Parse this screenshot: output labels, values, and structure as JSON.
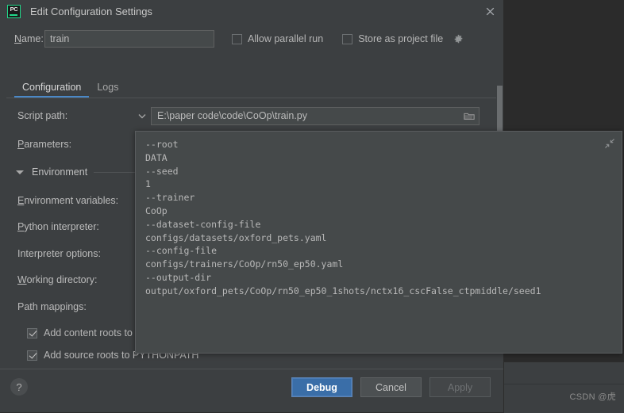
{
  "window": {
    "title": "Edit Configuration Settings",
    "app_icon": "pycharm-icon",
    "app_icon_text": "PC",
    "close_icon": "close-icon"
  },
  "name_row": {
    "label": "Name:",
    "label_mnemonic": "N",
    "value": "train",
    "checkboxes": [
      {
        "label": "Allow parallel run",
        "checked": false,
        "mnemonic": "u"
      },
      {
        "label": "Store as project file",
        "checked": false,
        "mnemonic": "S"
      }
    ],
    "gear_icon": "gear-icon"
  },
  "tabs": [
    {
      "label": "Configuration",
      "active": true
    },
    {
      "label": "Logs",
      "active": false
    }
  ],
  "form": {
    "script_path": {
      "label": "Script path:",
      "value": "E:\\paper code\\code\\CoOp\\train.py",
      "dropdown_icon": "chevron-down-icon",
      "browse_icon": "folder-icon"
    },
    "parameters": {
      "label": "Parameters:",
      "mnemonic": "P"
    },
    "environment_section": {
      "title": "Environment",
      "expanded": true,
      "toggle_icon": "triangle-down-icon"
    },
    "environment_variables": {
      "label": "Environment variables:",
      "mnemonic": "E"
    },
    "python_interpreter": {
      "label": "Python interpreter:",
      "mnemonic": "P"
    },
    "interpreter_options": {
      "label": "Interpreter options:"
    },
    "working_directory": {
      "label": "Working directory:",
      "mnemonic": "W"
    },
    "path_mappings": {
      "label": "Path mappings:"
    },
    "add_content_roots": {
      "label": "Add content roots to PYTHONPATH",
      "checked": true
    },
    "add_source_roots": {
      "label": "Add source roots to PYTHONPATH",
      "checked": true
    }
  },
  "parameters_popup": {
    "collapse_icon": "collapse-icon",
    "text": "--root\nDATA\n--seed\n1\n--trainer\nCoOp\n--dataset-config-file\nconfigs/datasets/oxford_pets.yaml\n--config-file\nconfigs/trainers/CoOp/rn50_ep50.yaml\n--output-dir\noutput/oxford_pets/CoOp/rn50_ep50_1shots/nctx16_cscFalse_ctpmiddle/seed1"
  },
  "footer": {
    "help_label": "?",
    "buttons": [
      {
        "label": "Debug",
        "style": "primary",
        "enabled": true
      },
      {
        "label": "Cancel",
        "style": "normal",
        "enabled": true
      },
      {
        "label": "Apply",
        "style": "disabled",
        "enabled": false
      }
    ]
  },
  "watermark": {
    "text": "CSDN @虎"
  },
  "colors": {
    "dialog_bg": "#3c3f41",
    "input_bg": "#45494a",
    "accent_blue": "#4a88c7",
    "primary_button": "#3a6ea8",
    "text": "#bbbbbb",
    "pycharm_green": "#21d789"
  }
}
